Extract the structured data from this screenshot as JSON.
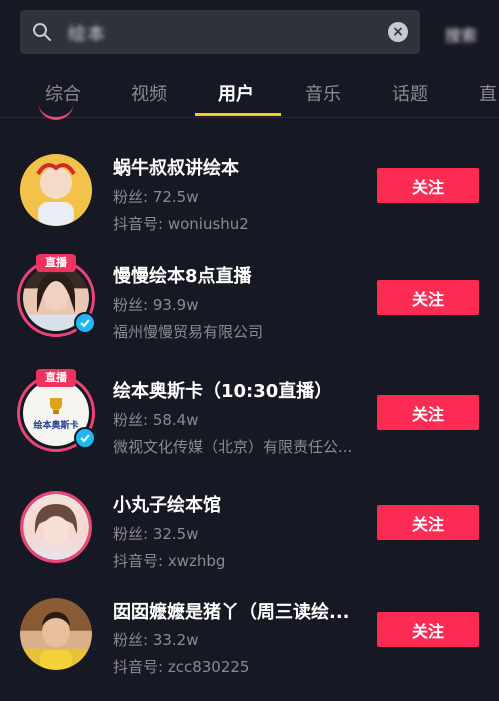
{
  "search": {
    "query": "绘本",
    "action_label": "搜索"
  },
  "tabs": [
    {
      "label": "综合"
    },
    {
      "label": "视频"
    },
    {
      "label": "用户",
      "active": true
    },
    {
      "label": "音乐"
    },
    {
      "label": "话题"
    },
    {
      "label": "直"
    }
  ],
  "users": [
    {
      "name": "蜗牛叔叔讲绘本",
      "followers": "粉丝: 72.5w",
      "sub": "抖音号: woniushu2",
      "follow_label": "关注",
      "live": false,
      "verified": false
    },
    {
      "name": "慢慢绘本8点直播",
      "followers": "粉丝: 93.9w",
      "sub": "福州慢慢贸易有限公司",
      "follow_label": "关注",
      "live": true,
      "live_label": "直播",
      "verified": true
    },
    {
      "name": "绘本奥斯卡（10:30直播）",
      "followers": "粉丝: 58.4w",
      "sub": "微视文化传媒（北京）有限责任公...",
      "follow_label": "关注",
      "live": true,
      "live_label": "直播",
      "verified": true,
      "avatar_text": "绘本奥斯卡"
    },
    {
      "name": "小丸子绘本馆",
      "followers": "粉丝: 32.5w",
      "sub": "抖音号: xwzhbg",
      "follow_label": "关注",
      "live": false,
      "verified": false
    },
    {
      "name": "囡囡嬷嬷是猪丫（周三读绘...",
      "followers": "粉丝: 33.2w",
      "sub": "抖音号: zcc830225",
      "follow_label": "关注",
      "live": false,
      "verified": false
    }
  ],
  "colors": {
    "background": "#161823",
    "accent_button": "#fe2c55",
    "tab_indicator": "#face15",
    "live_ring": "#ec4575",
    "verified": "#20b7f5"
  }
}
